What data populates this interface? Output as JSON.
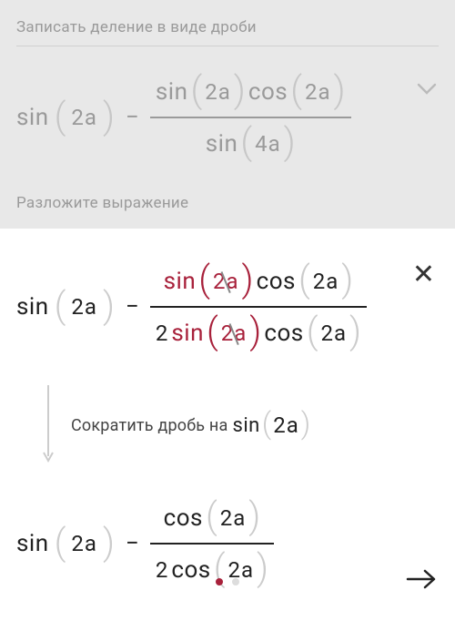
{
  "step1": {
    "label": "Записать деление в виде дроби"
  },
  "step2_label": "Разложите выражение",
  "hint": {
    "text": "Сократить дробь на",
    "fn": "sin",
    "arg": "2a"
  },
  "tokens": {
    "sin": "sin",
    "cos": "cos",
    "arg2a": "2a",
    "arg4a": "4a",
    "two": "2",
    "minus": "−"
  }
}
